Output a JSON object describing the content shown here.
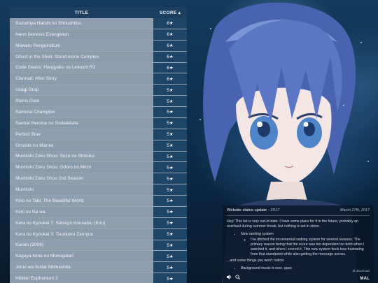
{
  "table": {
    "title_header": "TITLE",
    "score_header": "SCORE ▴",
    "rows": [
      {
        "title": "Suzumiya Haruhi no Shoushitsu",
        "score": "6★"
      },
      {
        "title": "Neon Genesis Evangelion",
        "score": "6★"
      },
      {
        "title": "Mawaru Penguindrum",
        "score": "6★"
      },
      {
        "title": "Ghost in the Shell: Stand Alone Complex",
        "score": "6★"
      },
      {
        "title": "Code Geass: Hangyaku no Lelouch R2",
        "score": "6★"
      },
      {
        "title": "Clannad: After Story",
        "score": "6★"
      },
      {
        "title": "Usagi Drop",
        "score": "5★"
      },
      {
        "title": "Steins;Gate",
        "score": "5★"
      },
      {
        "title": "Samurai Champloo",
        "score": "5★"
      },
      {
        "title": "Saenai Heroine no Sodatekata",
        "score": "5★"
      },
      {
        "title": "Perfect Blue",
        "score": "5★"
      },
      {
        "title": "Omoide no Marnie",
        "score": "5★"
      },
      {
        "title": "Mushishi Zoku Shou: Suzu no Shizuku",
        "score": "5★"
      },
      {
        "title": "Mushishi Zoku Shou: Odoro no Michi",
        "score": "5★"
      },
      {
        "title": "Mushishi Zoku Shou 2nd Season",
        "score": "5★"
      },
      {
        "title": "Mushishi",
        "score": "5★"
      },
      {
        "title": "Kino no Tabi: The Beautiful World",
        "score": "5★"
      },
      {
        "title": "Kimi no Na wa.",
        "score": "5★"
      },
      {
        "title": "Kara no Kyoukai 7: Satsujin Kousatsu (Kou)",
        "score": "5★"
      },
      {
        "title": "Kara no Kyoukai 3: Tsuukaku Zanryuu",
        "score": "5★"
      },
      {
        "title": "Kanon (2006)",
        "score": "5★"
      },
      {
        "title": "Kaguya-hime no Monogatari",
        "score": "5★"
      },
      {
        "title": "Jinrui wa Suitai Shimashita",
        "score": "5★"
      },
      {
        "title": "Hibike! Euphonium 2",
        "score": "5★"
      }
    ]
  },
  "status": {
    "title": "Website status update",
    "year": "2017",
    "date": "March 27th, 2017",
    "intro": "Hey! This list is very out-of-date. I have some plans for it in the future, probably an overhaul during summer break, but nothing is set in stone.",
    "item1_title": "New ranking system",
    "item1_sub": "I've ditched the incremental ranking system for several reasons. The primary reason being that the score was too dependent on both when I watched it, and when I scored it. This new system feels less frustrating from that standpoint while also getting the message across.",
    "outro": "...and some things you won't notice:",
    "item2_title": "Background music is now .opus",
    "download": "dl download",
    "logo": "MAL"
  },
  "icons": [
    "volume-icon",
    "search-icon"
  ]
}
